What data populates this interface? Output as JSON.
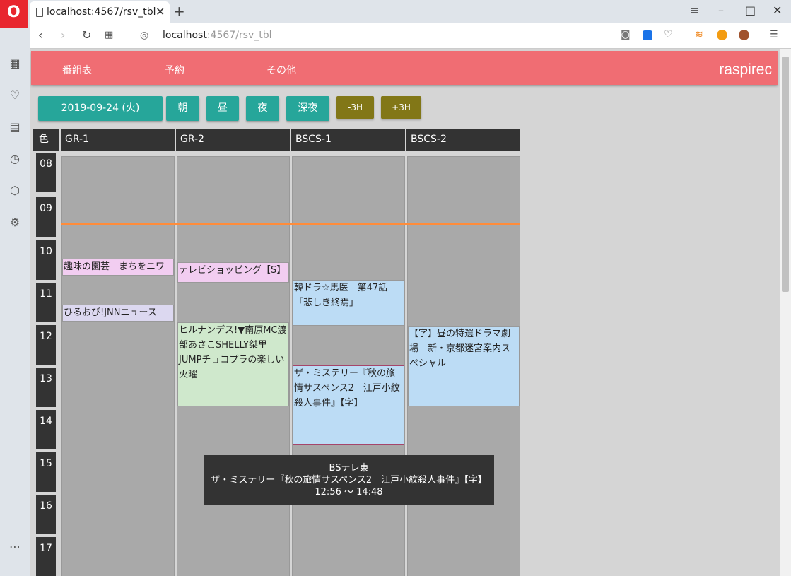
{
  "browser": {
    "tab_title": "localhost:4567/rsv_tbl",
    "address_host": "localhost",
    "address_path": ":4567/rsv_tbl"
  },
  "app": {
    "brand": "raspirec",
    "menu": [
      "番組表",
      "予約",
      "その他"
    ]
  },
  "controls": {
    "date": "2019-09-24 (火)",
    "periods": [
      "朝",
      "昼",
      "夜",
      "深夜"
    ],
    "shift_back": "-3H",
    "shift_forward": "+3H"
  },
  "grid": {
    "corner_label": "色",
    "channels": [
      "GR-1",
      "GR-2",
      "BSCS-1",
      "BSCS-2"
    ],
    "hours": [
      "08",
      "09",
      "10",
      "11",
      "12",
      "13",
      "14",
      "15",
      "16",
      "17"
    ]
  },
  "programs": {
    "gr1_a": "趣味の園芸　まちをニワ",
    "gr1_b": "ひるおび!JNNニュース",
    "gr2_a": "テレビショッピング【S】",
    "gr2_b": "ヒルナンデス!▼南原MC渡部あさこSHELLY桀里JUMPチョコプラの楽しい火曜",
    "bs1_a": "韓ドラ☆馬医　第47話「悲しき終焉」",
    "bs1_b": "ザ・ミステリー『秋の旅情サスペンス2　江戸小紋殺人事件』【字】",
    "bs2_a": "【字】昼の特選ドラマ劇場　新・京都迷宮案内スペシャル"
  },
  "tooltip": {
    "channel": "BSテレ東",
    "title": "ザ・ミステリー『秋の旅情サスペンス2　江戸小紋殺人事件』【字】",
    "time": "12:56 〜 14:48"
  },
  "colors": {
    "header": "#f06d73",
    "teal_button": "#26a69a",
    "olive_button": "#827717",
    "now_line": "#ff8c3a"
  }
}
